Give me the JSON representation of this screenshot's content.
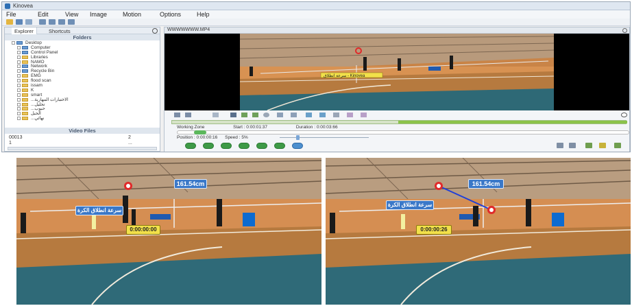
{
  "app": {
    "title": "Kinovea",
    "menu": [
      "File",
      "Edit",
      "View",
      "Image",
      "Motion",
      "Options",
      "Help"
    ]
  },
  "left_panel": {
    "tabs": [
      "Explorer",
      "Shortcuts"
    ],
    "folders_header": "Folders",
    "tree": [
      {
        "label": "Desktop",
        "icon": "desktop-icon",
        "indent": 0,
        "color": "blue"
      },
      {
        "label": "Computer",
        "icon": "computer-icon",
        "indent": 1,
        "color": "blue"
      },
      {
        "label": "Control Panel",
        "icon": "control-panel-icon",
        "indent": 1,
        "color": "blue"
      },
      {
        "label": "Libraries",
        "icon": "library-icon",
        "indent": 1,
        "color": "yellow"
      },
      {
        "label": "NAMO",
        "icon": "user-folder-icon",
        "indent": 1,
        "color": "yellow"
      },
      {
        "label": "Network",
        "icon": "network-icon",
        "indent": 1,
        "color": "blue"
      },
      {
        "label": "Recycle Bin",
        "icon": "recycle-bin-icon",
        "indent": 1,
        "color": "blue"
      },
      {
        "label": "EMG",
        "icon": "folder-icon",
        "indent": 1,
        "color": "yellow"
      },
      {
        "label": "flood scan",
        "icon": "folder-icon",
        "indent": 1,
        "color": "yellow"
      },
      {
        "label": "issam",
        "icon": "folder-icon",
        "indent": 1,
        "color": "yellow"
      },
      {
        "label": "K",
        "icon": "folder-icon",
        "indent": 1,
        "color": "yellow"
      },
      {
        "label": "smart",
        "icon": "folder-icon",
        "indent": 1,
        "color": "yellow"
      },
      {
        "label": "...الاختبارات المهارية",
        "icon": "folder-icon",
        "indent": 1,
        "color": "yellow"
      },
      {
        "label": "...تحليل",
        "icon": "folder-icon",
        "indent": 1,
        "color": "yellow"
      },
      {
        "label": "...حبوب",
        "icon": "folder-icon",
        "indent": 1,
        "color": "yellow"
      },
      {
        "label": "الحبل",
        "icon": "folder-icon",
        "indent": 1,
        "color": "yellow"
      },
      {
        "label": "...نهائي",
        "icon": "folder-icon",
        "indent": 1,
        "color": "yellow"
      }
    ],
    "video_files_header": "Video Files",
    "video_files": [
      {
        "name": "00013",
        "size": "2"
      },
      {
        "name": "1",
        "size": "..."
      }
    ]
  },
  "viewer": {
    "file_name": "WWWWWWW.MP4",
    "overlay_label": "سرعة انطلاق - Kinovea",
    "working_zone": "Working Zone",
    "start": "Start : 0:00:01:37",
    "duration": "Duration : 0:00:03:66",
    "position": "Position : 0:00:00:16",
    "speed": "Speed : 5%"
  },
  "frames": [
    {
      "distance_label": "161.54cm",
      "arabic_label": "سرعة انطلاق الكرة",
      "timer": "0:00:00:00",
      "line": false
    },
    {
      "distance_label": "161.54cm",
      "arabic_label": "سرعة انطلاق الكرة",
      "timer": "0:00:00:26",
      "line": true
    }
  ],
  "colors": {
    "floor": "#b8783b",
    "wall": "#d58e52",
    "court_blue": "#2f6a78",
    "label_blue": "#3a78c8",
    "timer_yellow": "#f2e04a",
    "marker_red": "#e02a2a",
    "line_blue": "#1f3fd8",
    "play_green": "#3e9a47"
  }
}
